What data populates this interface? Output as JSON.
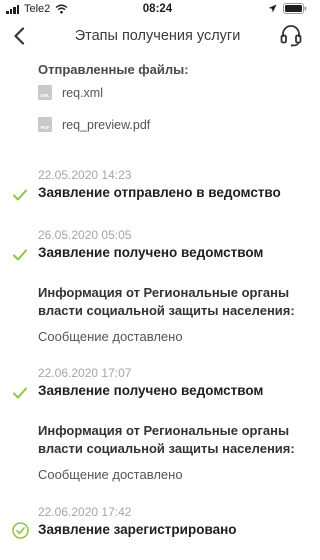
{
  "status_bar": {
    "carrier": "Tele2",
    "time": "08:24"
  },
  "nav": {
    "title": "Этапы получения услуги"
  },
  "files": {
    "heading": "Отправленные файлы:",
    "items": [
      {
        "icon_text": "XML",
        "name": "req.xml"
      },
      {
        "icon_text": "PDF",
        "name": "req_preview.pdf"
      }
    ]
  },
  "stages": [
    {
      "date": "22.05.2020 14:23",
      "title": "Заявление отправлено в ведомство",
      "status": "done"
    },
    {
      "date": "26.05.2020 05:05",
      "title": "Заявление получено ведомством",
      "info": "Информация от Региональные органы власти социальной защиты населения:",
      "message": "Сообщение доставлено",
      "status": "done"
    },
    {
      "date": "22.06.2020 17:07",
      "title": "Заявление получено ведомством",
      "info": "Информация от Региональные органы власти социальной защиты населения:",
      "message": "Сообщение доставлено",
      "status": "done"
    },
    {
      "date": "22.06.2020 17:42",
      "title": "Заявление зарегистрировано",
      "status": "current"
    }
  ],
  "colors": {
    "accent": "#8cc63f",
    "date": "#a5a5a5",
    "text": "#1f1f1f"
  },
  "icons": {
    "back": "chevron-left-icon",
    "support": "headset-icon",
    "check": "checkmark-icon",
    "check_circle": "check-circle-icon"
  }
}
